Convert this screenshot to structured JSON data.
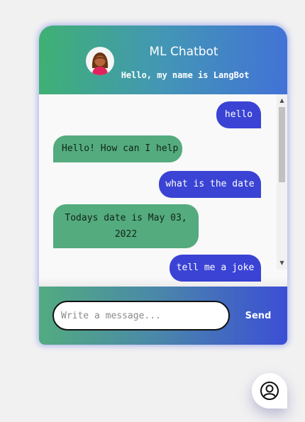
{
  "header": {
    "title": "ML Chatbot",
    "subtitle": "Hello, my name is LangBot",
    "avatar_icon": "woman-avatar-icon"
  },
  "messages": [
    {
      "from": "user",
      "text": "hello"
    },
    {
      "from": "bot",
      "text": "Hello! How can I help"
    },
    {
      "from": "user",
      "text": "what is the date"
    },
    {
      "from": "bot",
      "text_line1": "Todays date is May 03,",
      "text_line2": "2022"
    },
    {
      "from": "user",
      "text": "tell me a joke"
    }
  ],
  "scrollbar": {
    "up_glyph": "▲",
    "down_glyph": "▼"
  },
  "composer": {
    "placeholder": "Write a message...",
    "send_label": "Send"
  },
  "launcher": {
    "icon": "user-circle-icon"
  },
  "colors": {
    "user_bubble": "#3a43d4",
    "bot_bubble": "#54ab7e",
    "header_start": "#3fb173",
    "header_end": "#4272d6"
  }
}
